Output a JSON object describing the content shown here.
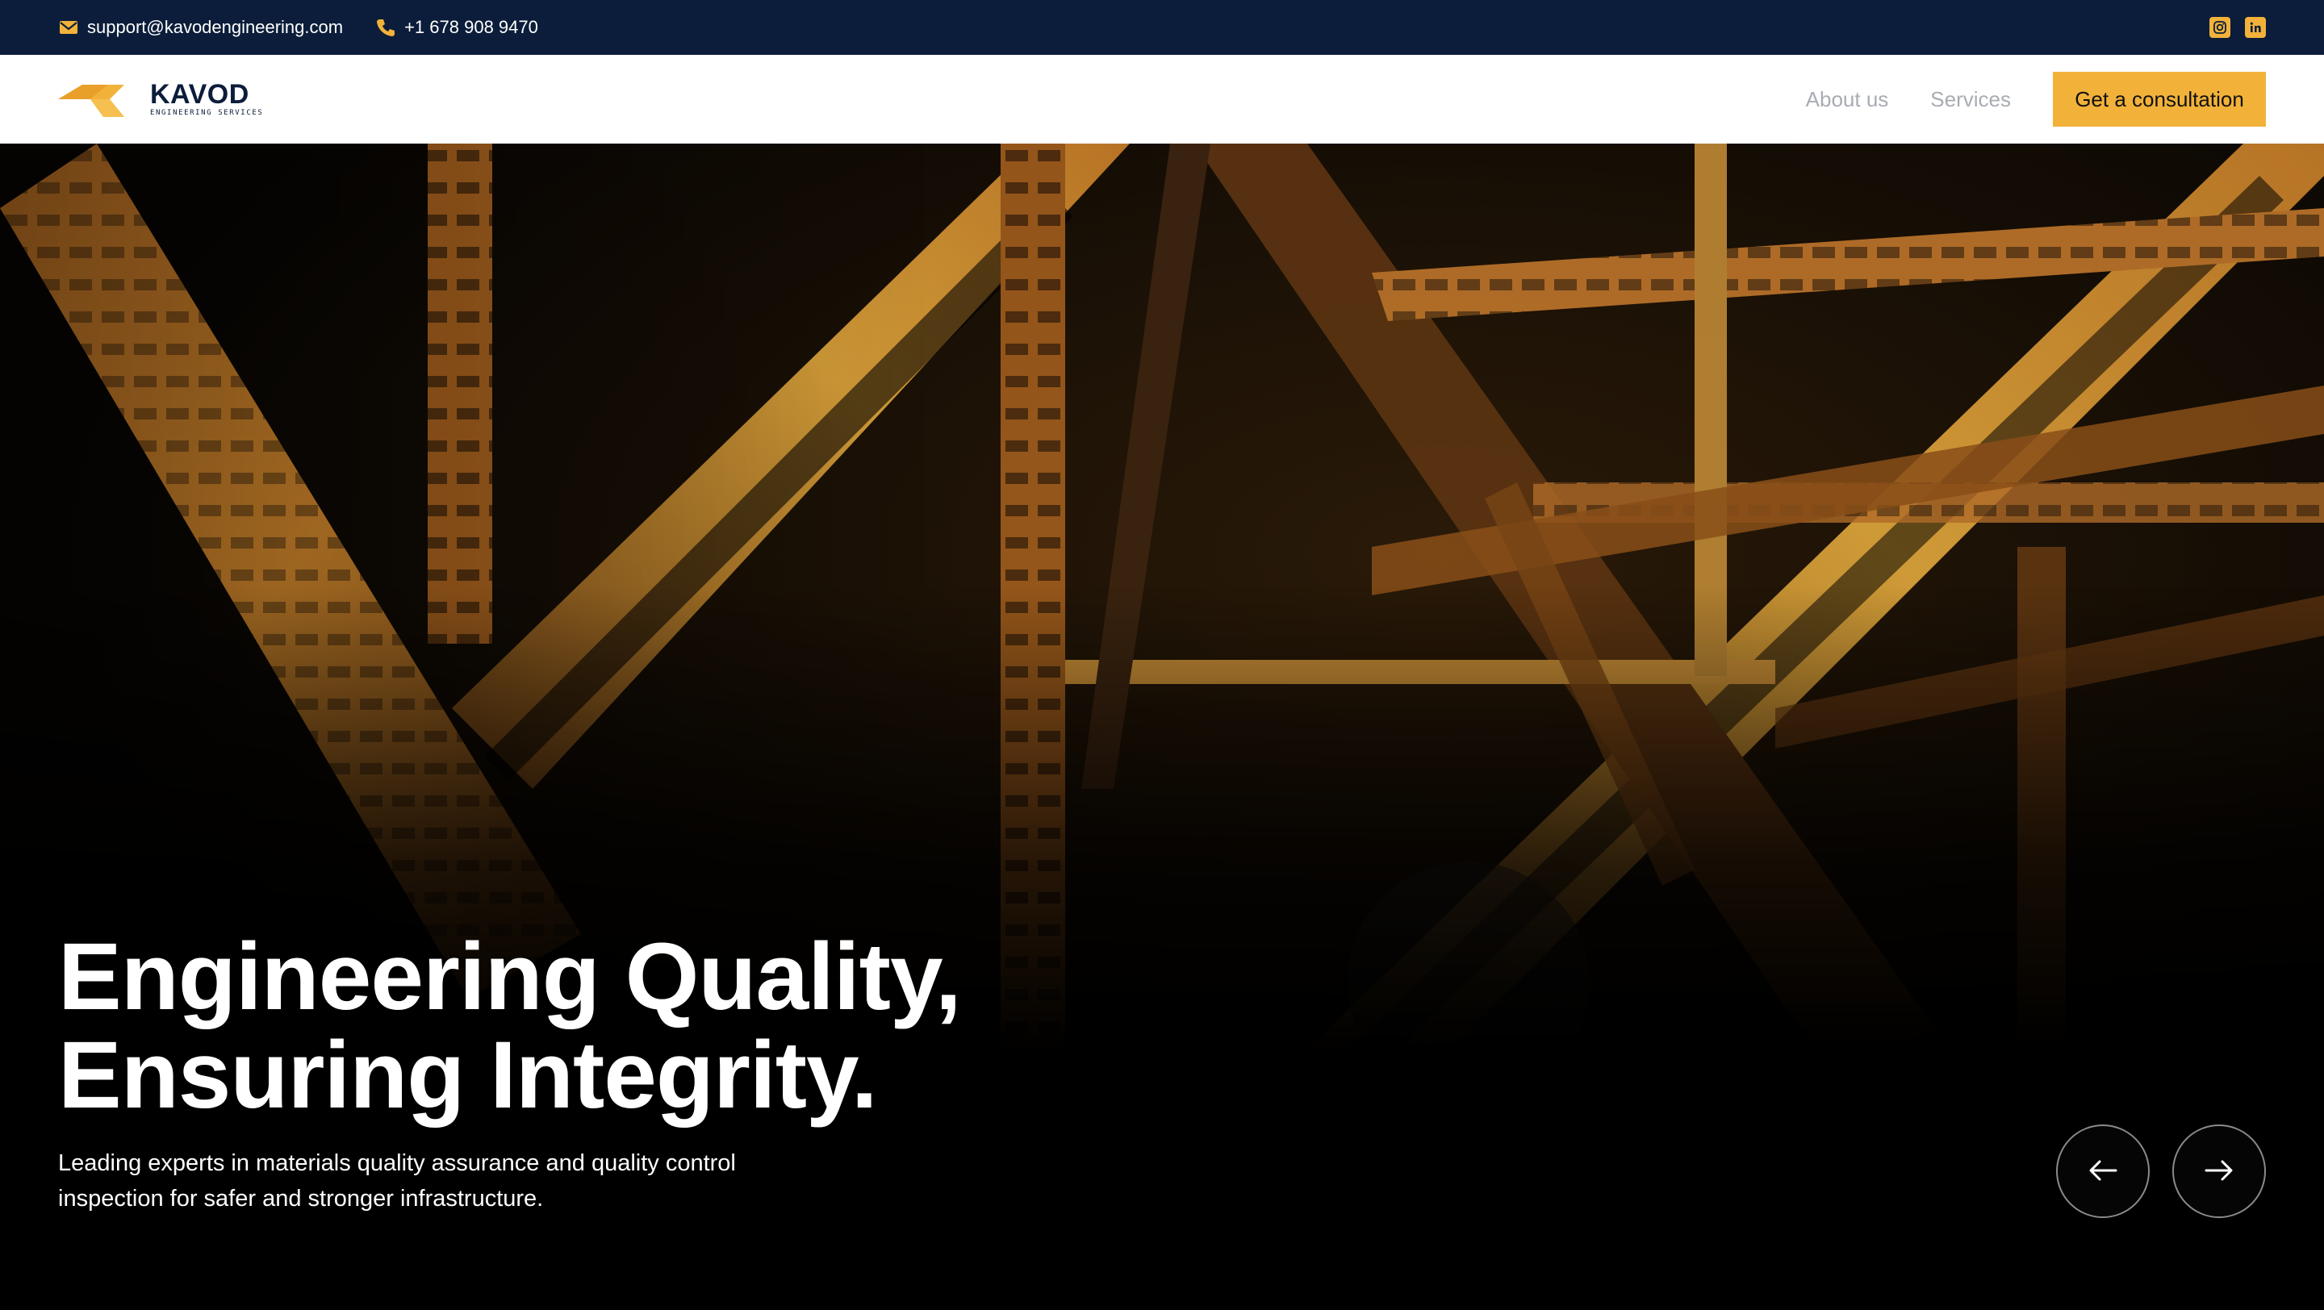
{
  "topbar": {
    "email": "support@kavodengineering.com",
    "phone": "+1 678 908 9470",
    "email_icon": "mail-icon",
    "phone_icon": "phone-icon",
    "social_icons": [
      "instagram-icon",
      "linkedin-icon"
    ]
  },
  "brand": {
    "name": "KAVOD",
    "tagline": "ENGINEERING SERVICES",
    "primary_color": "#0b1d3a",
    "accent_color": "#f2b23a"
  },
  "nav": {
    "links": [
      "About us",
      "Services"
    ],
    "cta_label": "Get a consultation"
  },
  "hero": {
    "headline_line1": "Engineering Quality,",
    "headline_line2": "Ensuring Integrity.",
    "subtext_line1": "Leading experts in materials quality assurance and quality control",
    "subtext_line2": "inspection for safer and stronger infrastructure.",
    "prev_icon": "arrow-left-icon",
    "next_icon": "arrow-right-icon"
  }
}
